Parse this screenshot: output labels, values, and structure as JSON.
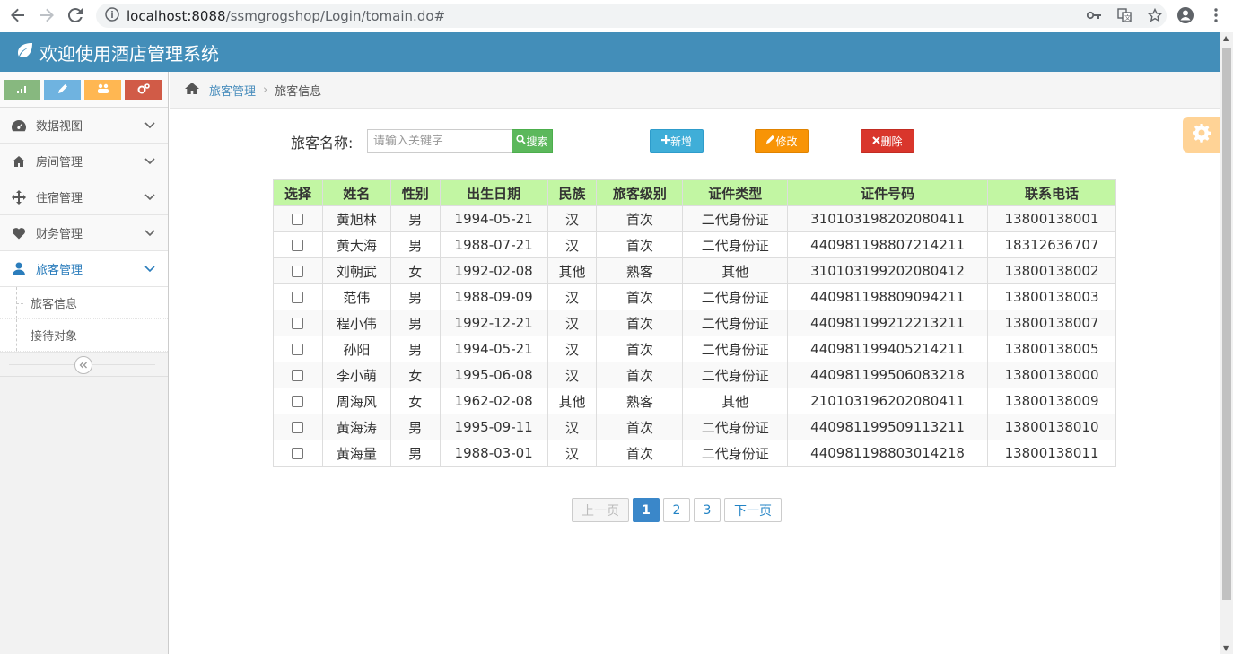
{
  "browser": {
    "url_host": "localhost:8088",
    "url_path": "/ssmgrogshop/Login/tomain.do#"
  },
  "app": {
    "title": "欢迎使用酒店管理系统"
  },
  "sidebar": {
    "items": [
      {
        "label": "数据视图"
      },
      {
        "label": "房间管理"
      },
      {
        "label": "住宿管理"
      },
      {
        "label": "财务管理"
      },
      {
        "label": "旅客管理"
      }
    ],
    "submenu": [
      "旅客信息",
      "接待对象"
    ]
  },
  "breadcrumb": {
    "parent": "旅客管理",
    "current": "旅客信息"
  },
  "toolbar": {
    "search_label": "旅客名称:",
    "search_placeholder": "请输入关键字",
    "search_button": "搜索",
    "add_button": "新增",
    "edit_button": "修改",
    "delete_button": "删除"
  },
  "table": {
    "headers": [
      "选择",
      "姓名",
      "性别",
      "出生日期",
      "民族",
      "旅客级别",
      "证件类型",
      "证件号码",
      "联系电话"
    ],
    "rows": [
      [
        "黄旭林",
        "男",
        "1994-05-21",
        "汉",
        "首次",
        "二代身份证",
        "310103198202080411",
        "13800138001"
      ],
      [
        "黄大海",
        "男",
        "1988-07-21",
        "汉",
        "首次",
        "二代身份证",
        "440981198807214211",
        "18312636707"
      ],
      [
        "刘朝武",
        "女",
        "1992-02-08",
        "其他",
        "熟客",
        "其他",
        "310103199202080412",
        "13800138002"
      ],
      [
        "范伟",
        "男",
        "1988-09-09",
        "汉",
        "首次",
        "二代身份证",
        "440981198809094211",
        "13800138003"
      ],
      [
        "程小伟",
        "男",
        "1992-12-21",
        "汉",
        "首次",
        "二代身份证",
        "440981199212213211",
        "13800138007"
      ],
      [
        "孙阳",
        "男",
        "1994-05-21",
        "汉",
        "首次",
        "二代身份证",
        "440981199405214211",
        "13800138005"
      ],
      [
        "李小萌",
        "女",
        "1995-06-08",
        "汉",
        "首次",
        "二代身份证",
        "440981199506083218",
        "13800138000"
      ],
      [
        "周海风",
        "女",
        "1962-02-08",
        "其他",
        "熟客",
        "其他",
        "210103196202080411",
        "13800138009"
      ],
      [
        "黄海涛",
        "男",
        "1995-09-11",
        "汉",
        "首次",
        "二代身份证",
        "440981199509113211",
        "13800138010"
      ],
      [
        "黄海量",
        "男",
        "1988-03-01",
        "汉",
        "首次",
        "二代身份证",
        "440981198803014218",
        "13800138011"
      ]
    ]
  },
  "pagination": {
    "prev": "上一页",
    "pages": [
      "1",
      "2",
      "3"
    ],
    "next": "下一页"
  },
  "colors": {
    "header_bg": "#438eb9",
    "table_header_bg": "#c2f6a3",
    "accent": "#2b7dbc"
  }
}
